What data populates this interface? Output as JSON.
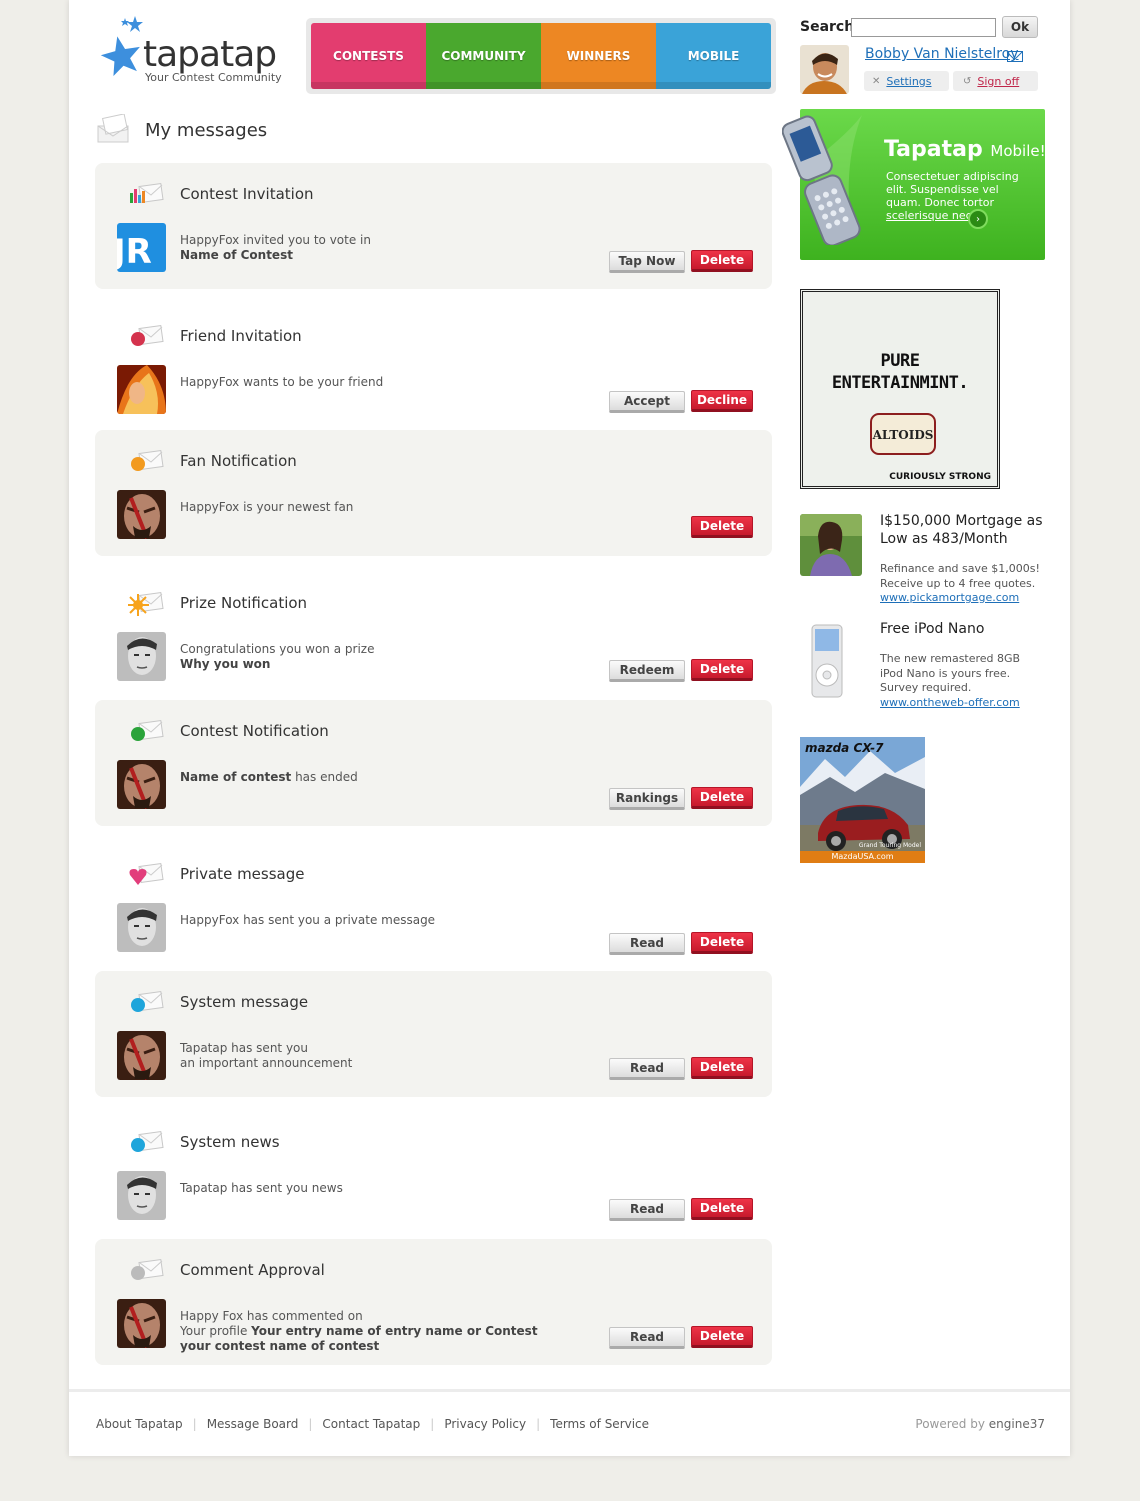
{
  "logo": {
    "name": "tapatap",
    "tagline": "Your Contest Community"
  },
  "nav": {
    "tabs": [
      {
        "label": "CONTESTS",
        "color": "#e33d6f"
      },
      {
        "label": "COMMUNITY",
        "color": "#4aa82e"
      },
      {
        "label": "WINNERS",
        "color": "#ed8723"
      },
      {
        "label": "MOBILE",
        "color": "#3aa3d8"
      }
    ]
  },
  "search": {
    "label": "Search",
    "value": "",
    "button": "Ok"
  },
  "user": {
    "name": "Bobby Van Nielstelroy",
    "settings": "Settings",
    "signoff": "Sign off"
  },
  "page": {
    "title": "My messages"
  },
  "messages": [
    {
      "title": "Contest Invitation",
      "line1": "HappyFox invited you to vote in",
      "line1_bold": "",
      "line2": "Name of Contest",
      "line3": "",
      "action": "Tap Now",
      "delete": "Delete",
      "icon": "chart-envelope-icon"
    },
    {
      "title": "Friend Invitation",
      "line1": "HappyFox wants to be your friend",
      "line1_bold": "",
      "line2": "",
      "line3": "",
      "action": "Accept",
      "delete": "Decline",
      "icon": "friend-envelope-icon"
    },
    {
      "title": "Fan Notification",
      "line1": "HappyFox is your newest fan",
      "line1_bold": "",
      "line2": "",
      "line3": "",
      "action": "",
      "delete": "Delete",
      "icon": "star-envelope-icon"
    },
    {
      "title": "Prize Notification",
      "line1": "Congratulations you won a prize",
      "line1_bold": "",
      "line2": "Why you won",
      "line3": "",
      "action": "Redeem",
      "delete": "Delete",
      "icon": "sun-envelope-icon"
    },
    {
      "title": "Contest Notification",
      "line1": " has ended",
      "line1_bold": "Name of contest",
      "line2": "",
      "line3": "",
      "action": "Rankings",
      "delete": "Delete",
      "icon": "contest-envelope-icon"
    },
    {
      "title": "Private message",
      "line1": "HappyFox has sent you a private message",
      "line1_bold": "",
      "line2": "",
      "line3": "",
      "action": "Read",
      "delete": "Delete",
      "icon": "heart-envelope-icon"
    },
    {
      "title": "System message",
      "line1": "Tapatap has sent you",
      "line1_bold": "",
      "line2": "",
      "line3": "an important announcement",
      "action": "Read",
      "delete": "Delete",
      "icon": "alert-envelope-icon"
    },
    {
      "title": "System news",
      "line1": "Tapatap has sent you news",
      "line1_bold": "",
      "line2": "",
      "line3": "",
      "action": "Read",
      "delete": "Delete",
      "icon": "news-envelope-icon"
    },
    {
      "title": "Comment Approval",
      "line1": "Happy Fox has commented on",
      "line1_bold": "",
      "line2": "Your Profile",
      "line3": "",
      "action": "Read",
      "delete": "Delete",
      "icon": "comment-envelope-icon"
    }
  ],
  "comment_detail": {
    "prefix": "Your profile ",
    "bold1": "Your entry name of  entry name or Contest",
    "bold2": "your contest name of contest"
  },
  "promo": {
    "title": "Tapatap",
    "title_suffix": "Mobile!",
    "text": "Consectetuer adipiscing elit. Suspendisse vel quam. Donec tortor",
    "link": "scelerisque nec"
  },
  "ad_altoids": {
    "headline1": "PURE",
    "headline2": "ENTERTAINMINT.",
    "brand": "ALTOIDS",
    "tagline": "CURIOUSLY STRONG"
  },
  "ads": [
    {
      "title": "I$150,000 Mortgage as Low as 483/Month",
      "text": "Refinance and save $1,000s! Receive up to 4 free quotes.",
      "link": "www.pickamortgage.com"
    },
    {
      "title": "Free iPod Nano",
      "text": "The new remastered 8GB iPod Nano is yours free. Survey required.",
      "link": "www.ontheweb-offer.com"
    }
  ],
  "ad_mazda": {
    "logo": "mazda CX-7",
    "caption": "Grand Touring Model",
    "site": "MazdaUSA.com"
  },
  "footer": {
    "links": [
      "About Tapatap",
      "Message Board",
      "Contact Tapatap",
      "Privacy Policy",
      "Terms of Service"
    ],
    "powered_prefix": "Powered by",
    "powered_brand": "engine37"
  }
}
